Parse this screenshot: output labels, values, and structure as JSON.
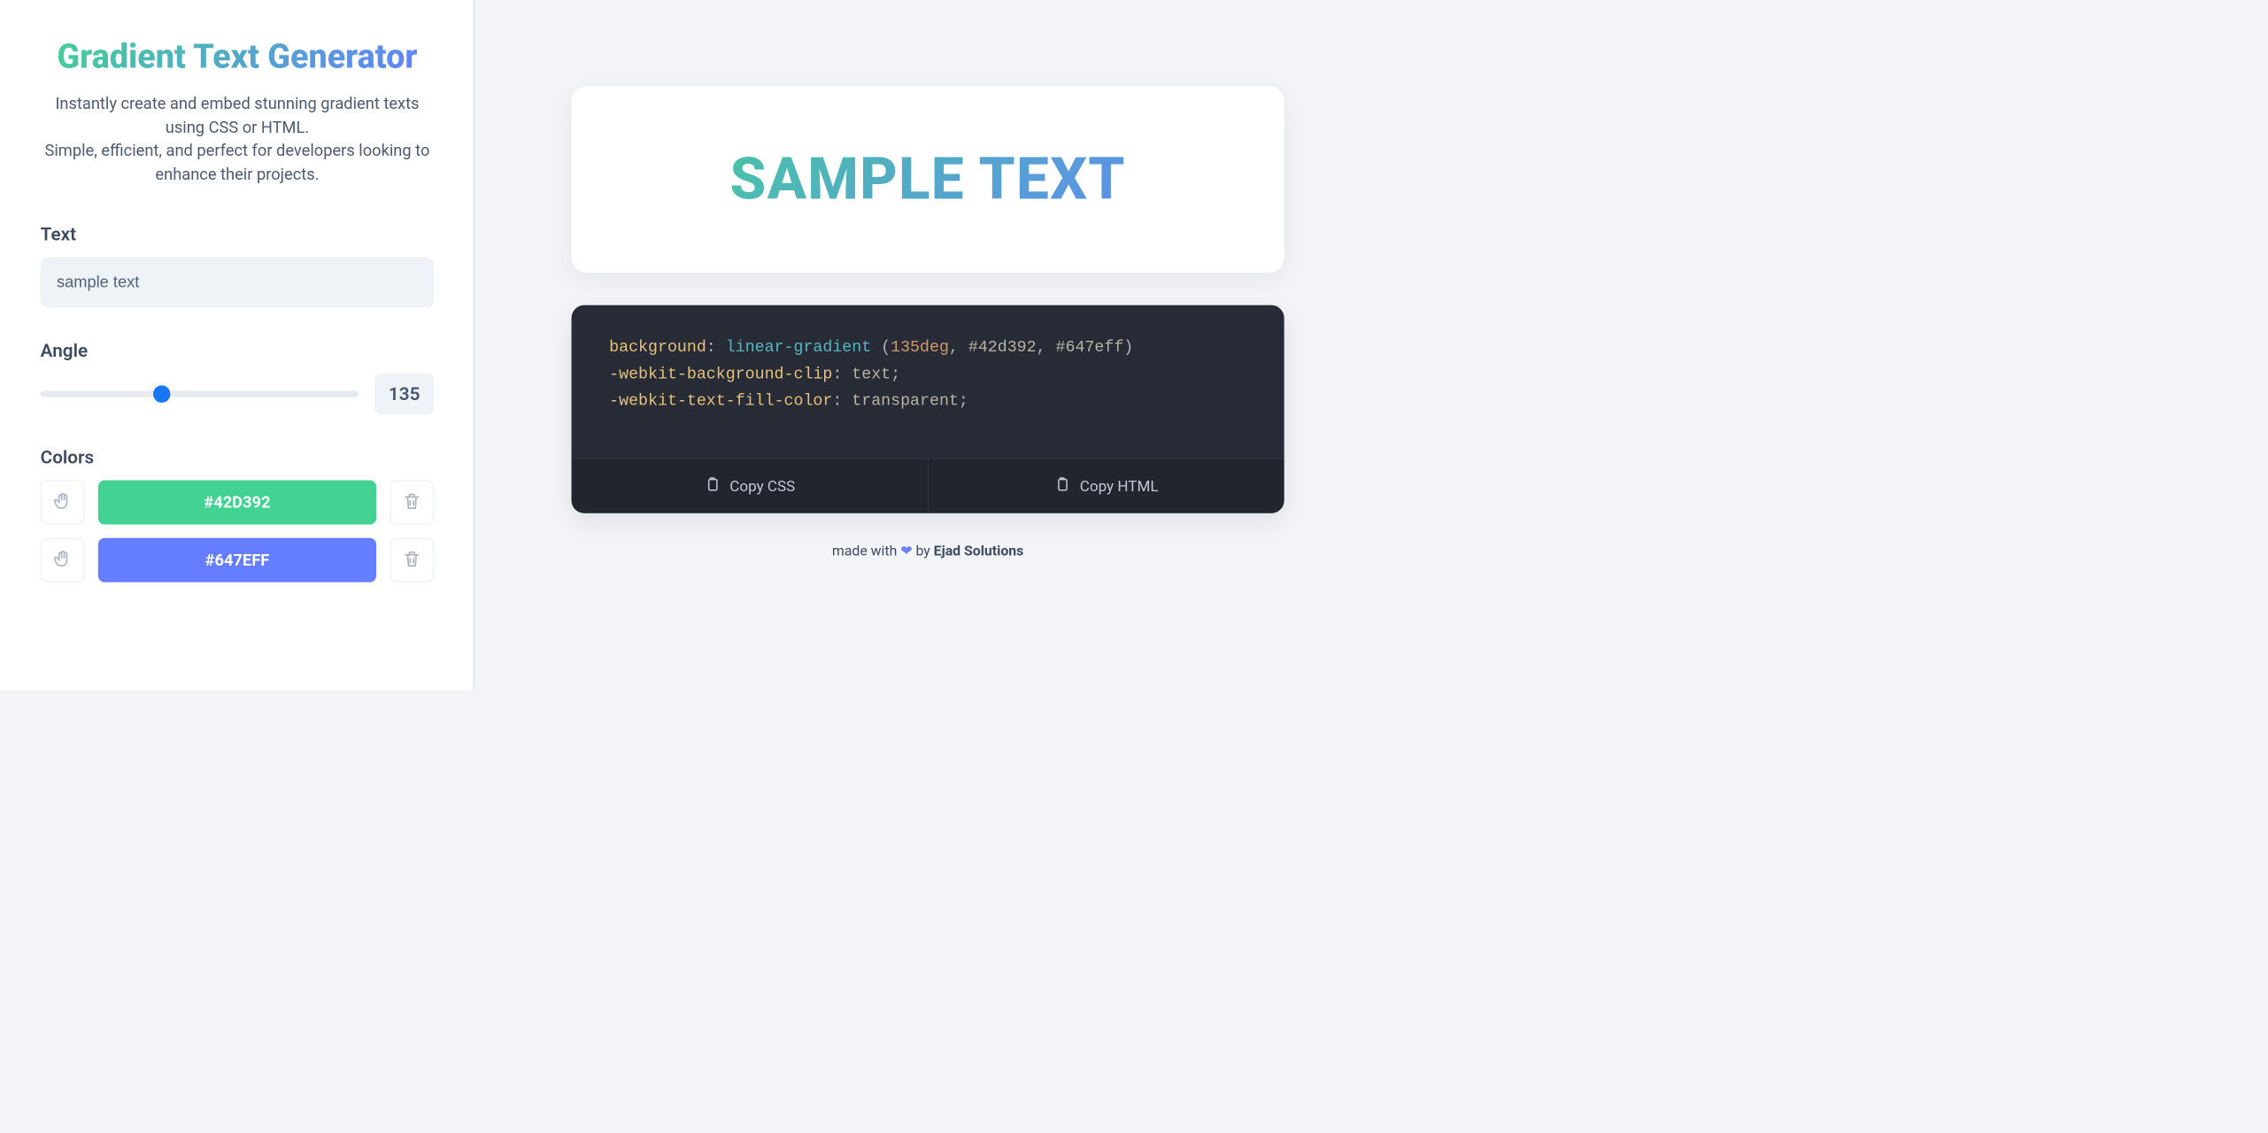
{
  "header": {
    "title": "Gradient Text Generator",
    "subtitle_line1": "Instantly create and embed stunning gradient texts using CSS or HTML.",
    "subtitle_line2": "Simple, efficient, and perfect for developers looking to enhance their projects."
  },
  "form": {
    "text_label": "Text",
    "text_value": "sample text",
    "angle_label": "Angle",
    "angle_value": "135",
    "angle_min": "0",
    "angle_max": "360",
    "colors_label": "Colors",
    "colors": [
      {
        "hex": "#42D392",
        "bg": "#42d392"
      },
      {
        "hex": "#647EFF",
        "bg": "#647eff"
      }
    ]
  },
  "preview": {
    "text": "SAMPLE TEXT"
  },
  "code": {
    "prop1": "background",
    "fn": "linear-gradient",
    "arg_angle": "135deg",
    "arg_c1": "#42d392",
    "arg_c2": "#647eff",
    "prop2": "-webkit-background-clip",
    "val2": "text",
    "prop3": "-webkit-text-fill-color",
    "val3": "transparent",
    "copy_css": "Copy CSS",
    "copy_html": "Copy HTML"
  },
  "footer": {
    "prefix": "made with ",
    "heart": "❤",
    "by": " by ",
    "brand": "Ejad Solutions"
  }
}
